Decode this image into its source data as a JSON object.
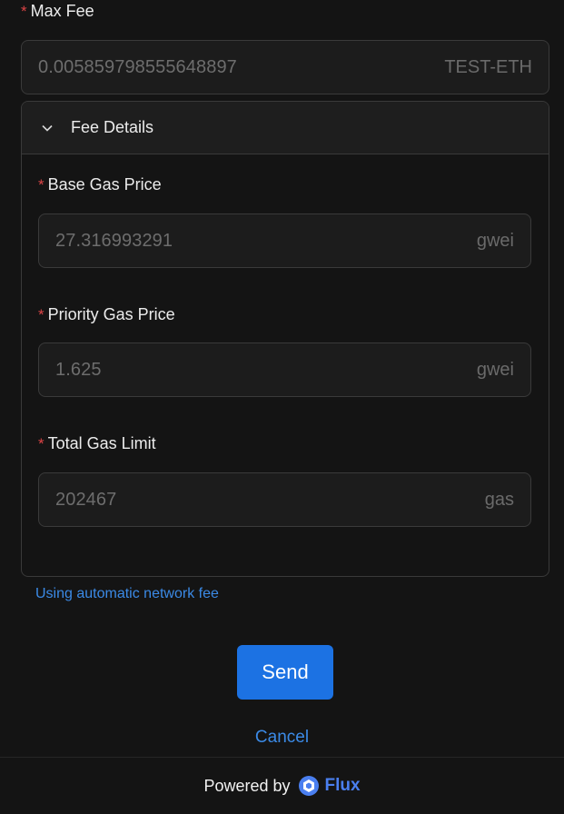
{
  "max_fee": {
    "required_mark": "*",
    "label": "Max Fee",
    "value": "0.005859798555648897",
    "unit": "TEST-ETH"
  },
  "fee_details": {
    "title": "Fee Details",
    "expanded": true,
    "base_gas_price": {
      "required_mark": "*",
      "label": "Base Gas Price",
      "value": "27.316993291",
      "unit": "gwei"
    },
    "priority_gas_price": {
      "required_mark": "*",
      "label": "Priority Gas Price",
      "value": "1.625",
      "unit": "gwei"
    },
    "total_gas_limit": {
      "required_mark": "*",
      "label": "Total Gas Limit",
      "value": "202467",
      "unit": "gas"
    }
  },
  "auto_fee_link": "Using automatic network fee",
  "actions": {
    "send_label": "Send",
    "cancel_label": "Cancel"
  },
  "footer": {
    "powered_by": "Powered by",
    "brand": "Flux",
    "logo_icon": "flux-logo-icon"
  },
  "colors": {
    "background": "#141414",
    "accent": "#1c72e3",
    "link": "#3b8ae6",
    "required": "#dc4446",
    "brand": "#4a7ff0"
  }
}
